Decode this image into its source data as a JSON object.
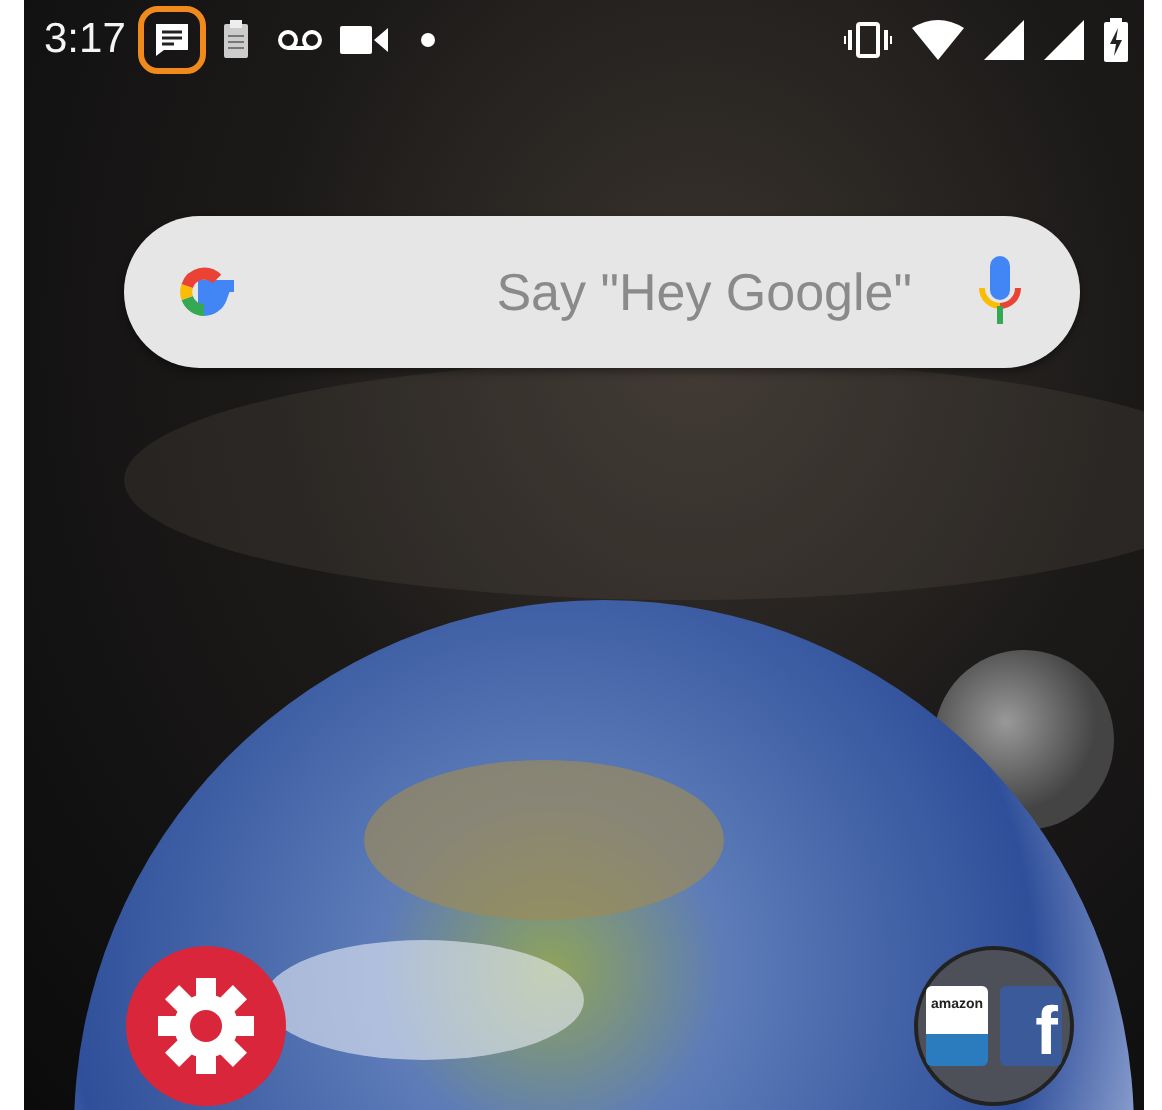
{
  "status_bar": {
    "time": "3:17",
    "notifications": [
      {
        "kind": "message",
        "highlighted": true
      },
      {
        "kind": "clipboard",
        "highlighted": false
      },
      {
        "kind": "voicemail",
        "highlighted": false
      },
      {
        "kind": "video",
        "highlighted": false
      },
      {
        "kind": "dot",
        "highlighted": false
      }
    ]
  },
  "search": {
    "placeholder": "Say \"Hey Google\""
  },
  "dock": [
    {
      "kind": "settings"
    },
    {
      "kind": "folder",
      "apps": [
        {
          "kind": "amazon",
          "label": "amazon"
        },
        {
          "kind": "facebook",
          "label": "f"
        }
      ]
    }
  ]
}
